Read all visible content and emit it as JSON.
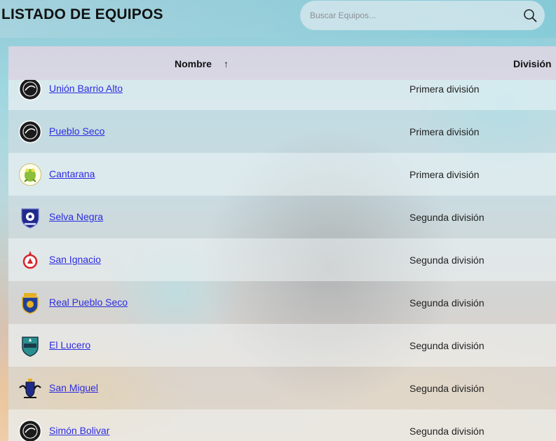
{
  "header": {
    "title": "LISTADO DE EQUIPOS",
    "search_placeholder": "Buscar Equipos..."
  },
  "table": {
    "columns": {
      "name": "Nombre",
      "division": "División"
    },
    "sort_indicator": "↑",
    "rows": [
      {
        "name": "Unión Barrio Alto",
        "division": "Primera división",
        "logo": "dark-shield-icon"
      },
      {
        "name": "Pueblo Seco",
        "division": "Primera división",
        "logo": "dark-shield-icon"
      },
      {
        "name": "Cantarana",
        "division": "Primera división",
        "logo": "frog-crest-icon"
      },
      {
        "name": "Selva Negra",
        "division": "Segunda división",
        "logo": "blue-shield-icon"
      },
      {
        "name": "San Ignacio",
        "division": "Segunda división",
        "logo": "red-emblem-icon"
      },
      {
        "name": "Real Pueblo Seco",
        "division": "Segunda división",
        "logo": "blue-gold-crest-icon"
      },
      {
        "name": "El Lucero",
        "division": "Segunda división",
        "logo": "teal-shield-icon"
      },
      {
        "name": "San Miguel",
        "division": "Segunda división",
        "logo": "winged-crest-icon"
      },
      {
        "name": "Simón Bolivar",
        "division": "Segunda división",
        "logo": "dark-shield-icon"
      }
    ]
  },
  "colors": {
    "link": "#2c2ce0",
    "header_bg": "#d8d4e2"
  }
}
